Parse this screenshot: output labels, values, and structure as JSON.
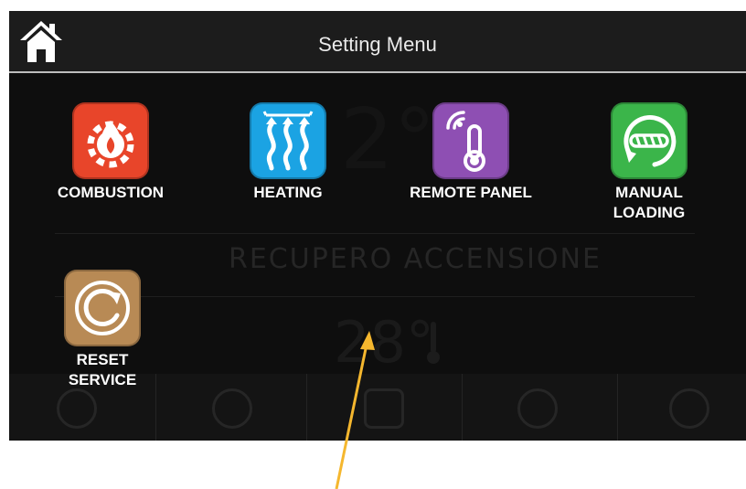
{
  "header": {
    "title": "Setting Menu",
    "home_icon": "home-icon"
  },
  "background_screen": {
    "temperature": "2°",
    "status": "RECUPERO ACCENSIONE",
    "room_temperature": "28°",
    "thermometer_icon": "thermometer-icon"
  },
  "menu": {
    "items": [
      {
        "label": "COMBUSTION",
        "icon": "flame-gear-icon",
        "color": "#e8452a"
      },
      {
        "label": "HEATING",
        "icon": "heat-waves-icon",
        "color": "#1ba3e3"
      },
      {
        "label": "REMOTE PANEL",
        "icon": "remote-thermometer-icon",
        "color": "#8e4fb3"
      },
      {
        "label": "MANUAL\nLOADING",
        "icon": "auger-loading-icon",
        "color": "#3bb54a"
      },
      {
        "label": "RESET\nSERVICE",
        "icon": "reset-cycle-icon",
        "color": "#b88a55"
      }
    ]
  },
  "annotation": {
    "arrow_color": "#f5b72e"
  }
}
